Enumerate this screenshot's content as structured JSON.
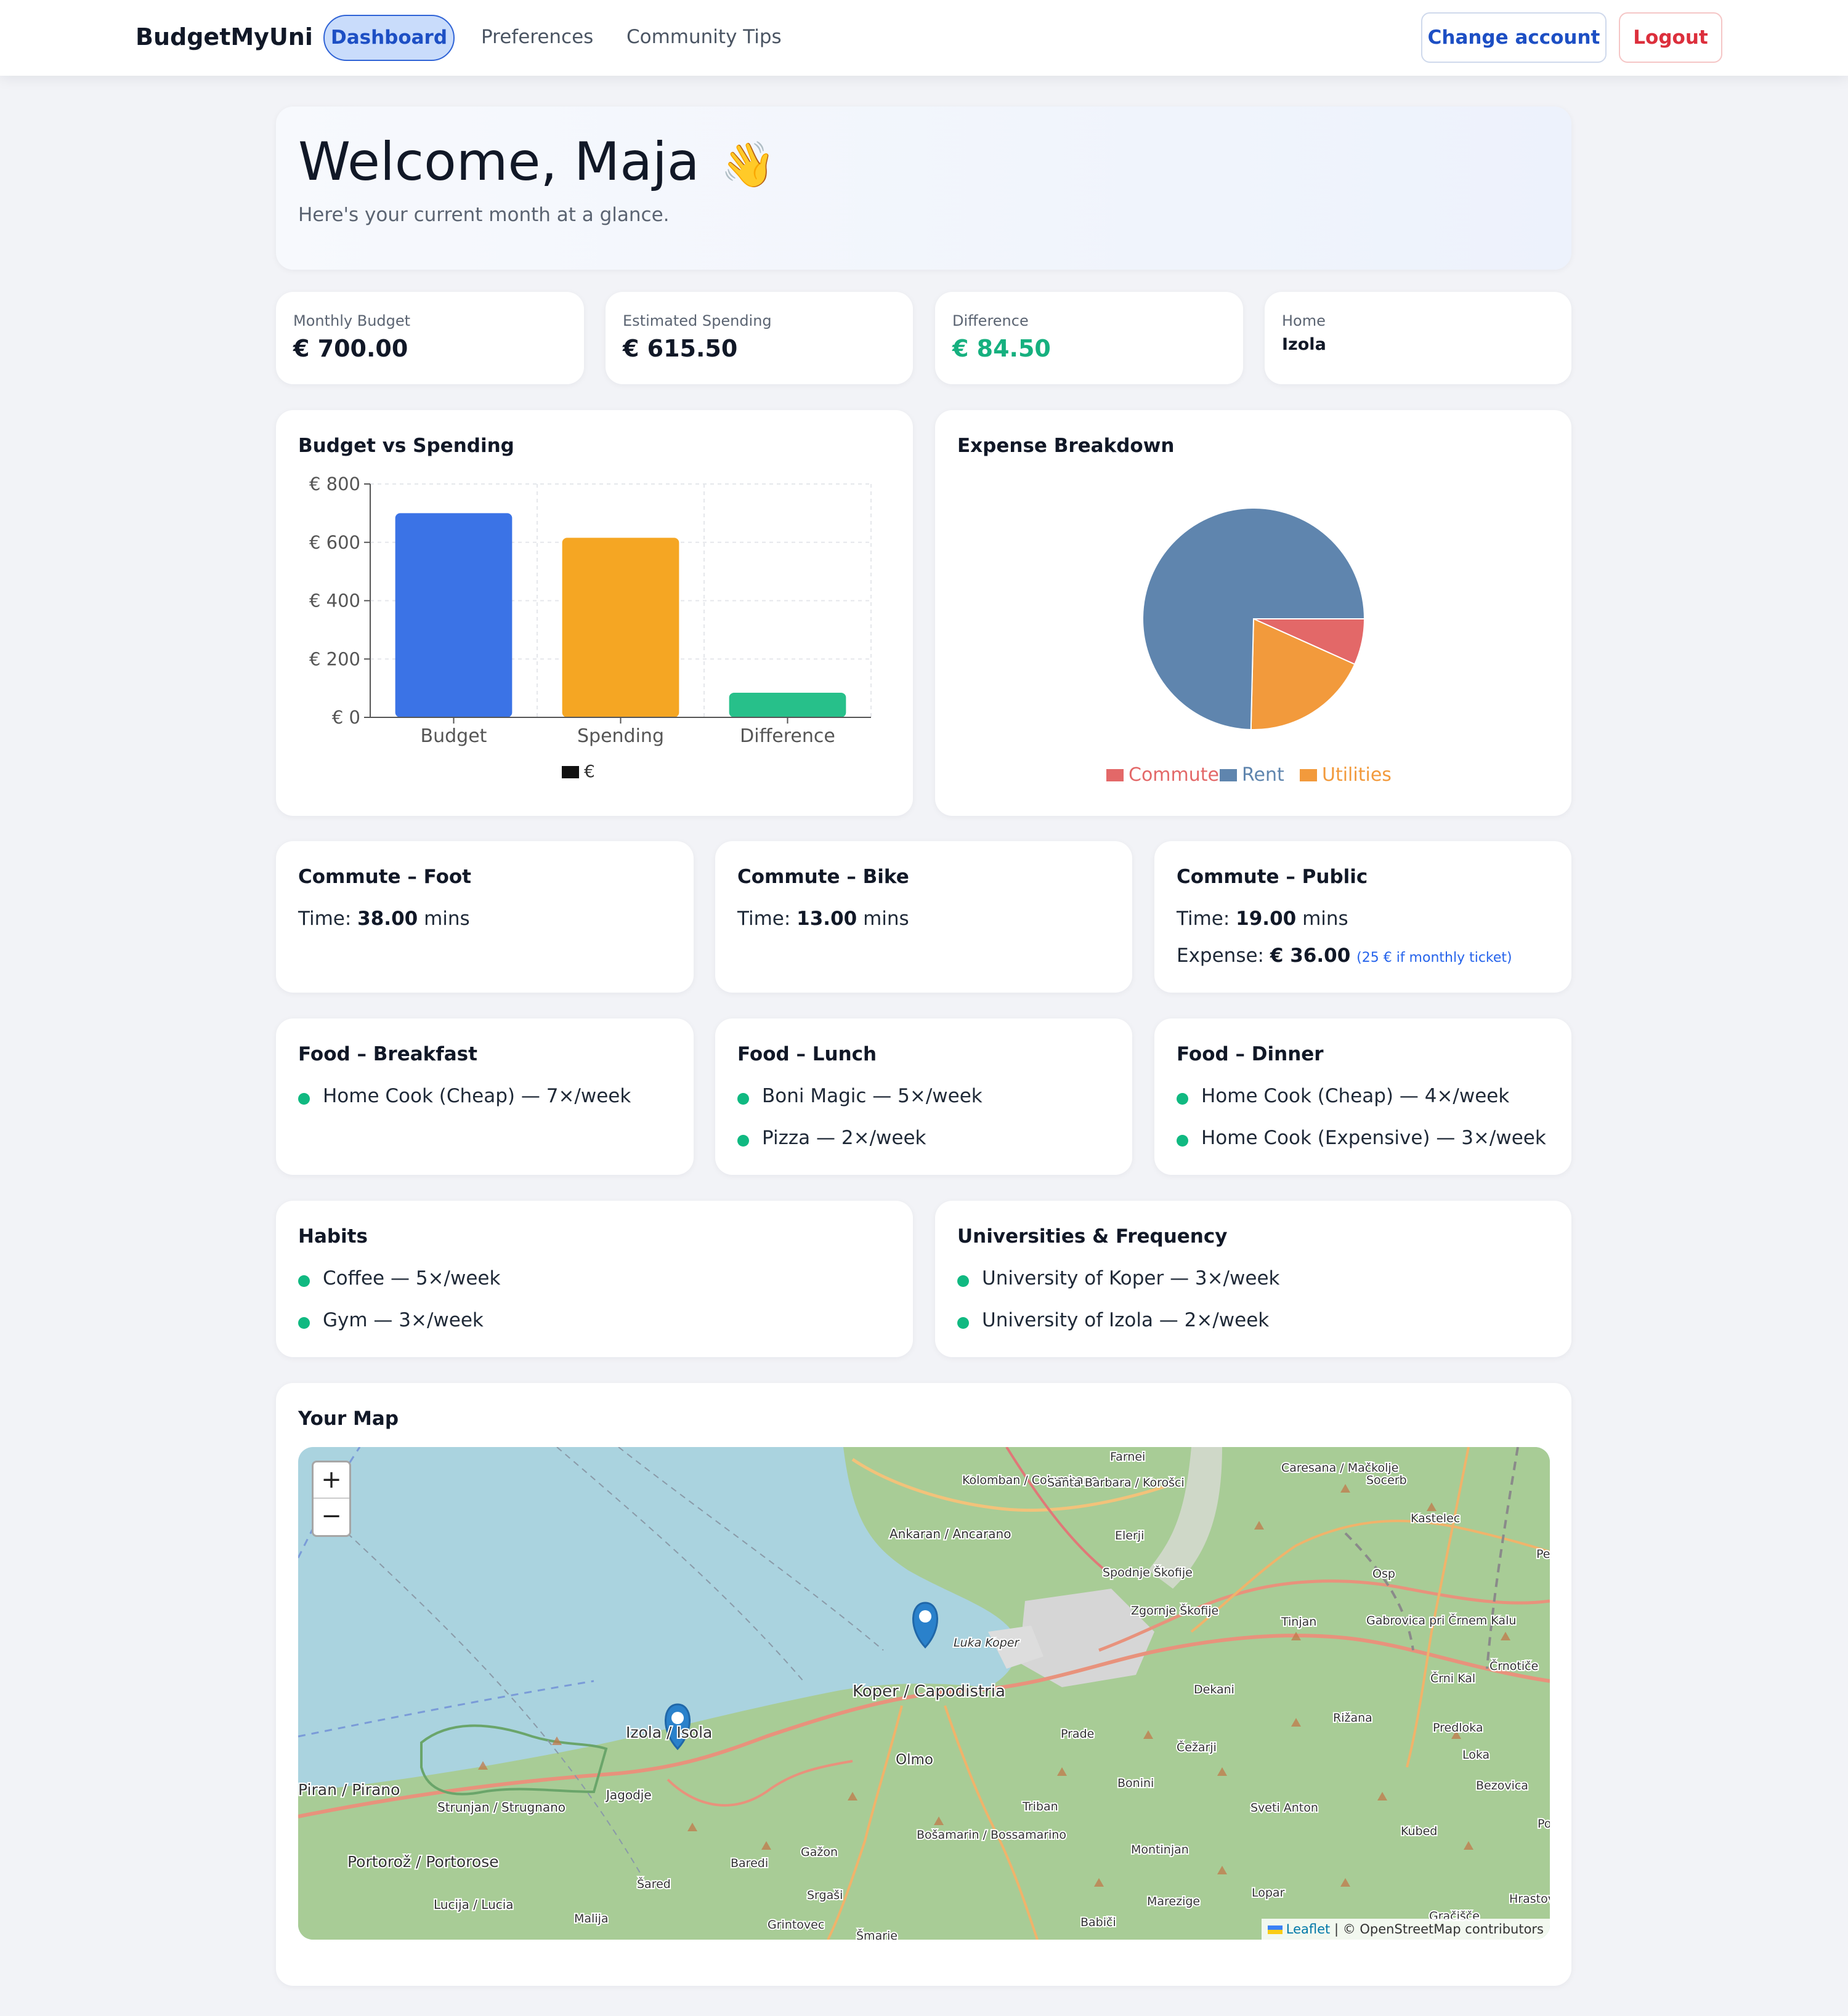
{
  "nav": {
    "brand": "BudgetMyUni",
    "active_tab": "Dashboard",
    "links": [
      "Preferences",
      "Community Tips"
    ],
    "change_account": "Change account",
    "logout": "Logout"
  },
  "welcome": {
    "title": "Welcome, Maja",
    "emoji": "👋",
    "subtitle": "Here's your current month at a glance."
  },
  "stats": [
    {
      "label": "Monthly Budget",
      "value": "€ 700.00"
    },
    {
      "label": "Estimated Spending",
      "value": "€ 615.50"
    },
    {
      "label": "Difference",
      "value": "€ 84.50"
    },
    {
      "label": "Home",
      "value": "Izola"
    }
  ],
  "colors": {
    "budget": "#3b73e6",
    "spending": "#f5a623",
    "difference": "#27c08a",
    "commute": "#e36868",
    "rent": "#5f85ae",
    "utilities": "#f29a3c",
    "bullet": "#10b981",
    "positive": "#16b07f"
  },
  "chart_data": [
    {
      "type": "bar",
      "title": "Budget vs Spending",
      "categories": [
        "Budget",
        "Spending",
        "Difference"
      ],
      "series": [
        {
          "name": "€",
          "values": [
            700,
            615.5,
            84.5
          ]
        }
      ],
      "ylim": [
        0,
        800
      ],
      "yticks": [
        "€ 0",
        "€ 200",
        "€ 400",
        "€ 600",
        "€ 800"
      ],
      "grid": true,
      "legend": "bottom"
    },
    {
      "type": "pie",
      "title": "Expense Breakdown",
      "categories": [
        "Commute",
        "Rent",
        "Utilities"
      ],
      "values": [
        36,
        400,
        100
      ],
      "legend": "bottom"
    }
  ],
  "commute": [
    {
      "title": "Commute – Foot",
      "time_label": "Time:",
      "time": "38.00",
      "unit": "mins"
    },
    {
      "title": "Commute – Bike",
      "time_label": "Time:",
      "time": "13.00",
      "unit": "mins"
    },
    {
      "title": "Commute – Public",
      "time_label": "Time:",
      "time": "19.00",
      "unit": "mins",
      "expense_label": "Expense:",
      "expense": "€ 36.00",
      "note": "(25 € if monthly ticket)"
    }
  ],
  "food": [
    {
      "title": "Food – Breakfast",
      "items": [
        "Home Cook (Cheap) — 7×/week"
      ]
    },
    {
      "title": "Food – Lunch",
      "items": [
        "Boni Magic — 5×/week",
        "Pizza — 2×/week"
      ]
    },
    {
      "title": "Food – Dinner",
      "items": [
        "Home Cook (Cheap) — 4×/week",
        "Home Cook (Expensive) — 3×/week"
      ]
    }
  ],
  "habits": {
    "title": "Habits",
    "items": [
      "Coffee — 5×/week",
      "Gym — 3×/week"
    ]
  },
  "universities": {
    "title": "Universities & Frequency",
    "items": [
      "University of Koper — 3×/week",
      "University of Izola — 2×/week"
    ]
  },
  "map": {
    "title": "Your Map",
    "zoom_in": "+",
    "zoom_out": "−",
    "attribution_link": "Leaflet",
    "attribution_text": "| © OpenStreetMap contributors",
    "places": {
      "koper": "Koper / Capodistria",
      "izola": "Izola / Isola",
      "piran": "Piran / Pirano",
      "portoroz": "Portorož / Portorose",
      "lucija": "Lucija / Lucia",
      "strunjan": "Strunjan / Strugnano",
      "jagodje": "Jagodje",
      "olmo": "Olmo",
      "ankaran": "Ankaran / Ancarano",
      "kolomban": "Kolomban / Colombano",
      "santa_barbara": "Santa Barbara / Korošci",
      "farnei": "Farnei",
      "elerji": "Elerji",
      "spodnje": "Spodnje Škofije",
      "zgornje": "Zgornje Škofije",
      "caresana": "Caresana / Mačkolje",
      "socerb": "Socerb",
      "kastelec": "Kastelec",
      "osp": "Osp",
      "tinjan": "Tinjan",
      "gabrovica": "Gabrovica pri Črnem Kalu",
      "crni_kal": "Črni Kal",
      "crnotice": "Črnotiče",
      "dekani": "Dekani",
      "rizana": "Rižana",
      "predloka": "Predloka",
      "loka": "Loka",
      "bezovica": "Bezovica",
      "prade": "Prade",
      "cezarji": "Čežarji",
      "bonini": "Bonini",
      "triban": "Triban",
      "sveti_anton": "Sveti Anton",
      "kubed": "Kubed",
      "bosamarin": "Bošamarin / Bossamarino",
      "montinjan": "Montinjan",
      "gazon": "Gažon",
      "baredi": "Baredi",
      "sared": "Šared",
      "srgasi": "Srgaši",
      "malija": "Malija",
      "grintovec": "Grintovec",
      "smarje": "Šmarje",
      "babici": "Babiči",
      "marezige": "Marezige",
      "lopar": "Lopar",
      "gracisce": "Gračišče",
      "hrastov": "Hrastov",
      "luka_koper": "Luka Koper",
      "pe": "Pe",
      "po": "Po"
    }
  }
}
